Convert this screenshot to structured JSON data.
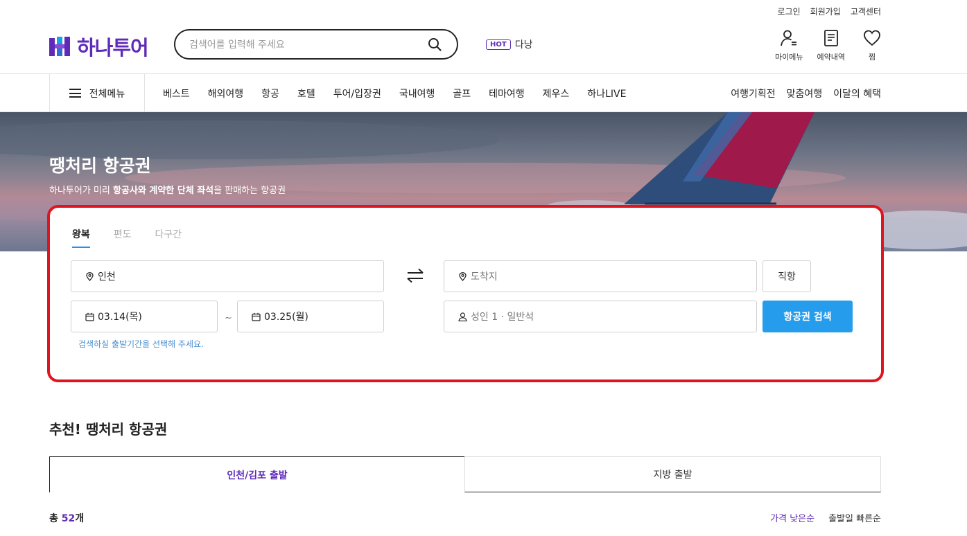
{
  "utility_links": [
    "로그인",
    "회원가입",
    "고객센터"
  ],
  "brand": {
    "name": "하나투어",
    "color": "#5e2bb8"
  },
  "search": {
    "placeholder": "검색어를 입력해 주세요",
    "icon": "search-icon"
  },
  "hot": {
    "badge": "HOT",
    "keyword": "다낭"
  },
  "header_icons": [
    {
      "label": "마이메뉴",
      "icon": "user-menu-icon"
    },
    {
      "label": "예약내역",
      "icon": "document-icon"
    },
    {
      "label": "찜",
      "icon": "heart-icon"
    }
  ],
  "nav": {
    "all_menu_label": "전체메뉴",
    "links": [
      "베스트",
      "해외여행",
      "항공",
      "호텔",
      "투어/입장권",
      "국내여행",
      "골프",
      "테마여행",
      "제우스",
      "하나LIVE"
    ],
    "right_links": [
      "여행기획전",
      "맞춤여행",
      "이달의 혜택"
    ]
  },
  "hero": {
    "title": "땡처리 항공권",
    "subtitle_prefix": "하나투어가 미리 ",
    "subtitle_bold": "항공사와 계약한 단체 좌석",
    "subtitle_suffix": "을 판매하는 항공권"
  },
  "flight_search": {
    "tabs": [
      "왕복",
      "편도",
      "다구간"
    ],
    "active_tab": "왕복",
    "origin": "인천",
    "destination_placeholder": "도착지",
    "depart_date": "03.14(목)",
    "return_date": "03.25(월)",
    "date_separator": "~",
    "passengers": "성인 1 · 일반석",
    "direct_label": "직항",
    "search_button": "항공권 검색",
    "hint": "검색하실 출발기간을 선택해 주세요.",
    "accent_color": "#259cec",
    "highlight_border_color": "#e0141e"
  },
  "recommend": {
    "title": "추천! 땡처리 항공권",
    "tabs": [
      "인천/김포 출발",
      "지방 출발"
    ],
    "active_tab": "인천/김포 출발",
    "total_prefix": "총 ",
    "total_count": "52",
    "total_suffix": "개",
    "sort_options": [
      "가격 낮은순",
      "출발일 빠른순"
    ],
    "active_sort": "가격 낮은순"
  }
}
